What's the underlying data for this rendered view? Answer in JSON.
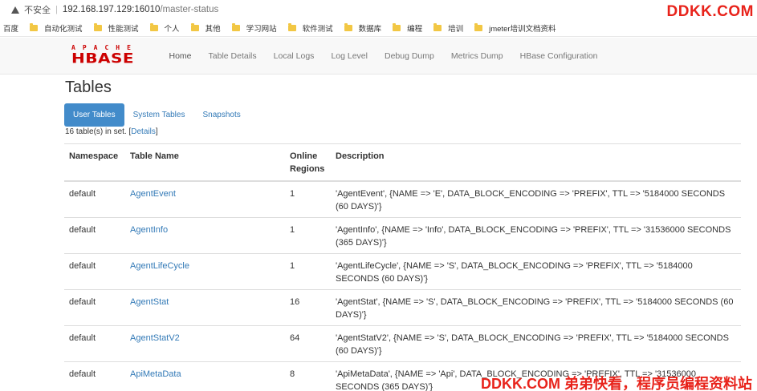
{
  "browser": {
    "security_label": "不安全",
    "url_host": "192.168.197.129:16010",
    "url_path": "/master-status"
  },
  "bookmarks": [
    "百度",
    "自动化测试",
    "性能测试",
    "个人",
    "其他",
    "学习网站",
    "软件测试",
    "数据库",
    "编程",
    "培训",
    "jmeter培训文档资料"
  ],
  "watermark": {
    "top": "DDKK.COM",
    "bottom": "DDKK.COM 弟弟快看，程序员编程资料站"
  },
  "logo": {
    "apache": "APACHE",
    "hbase": "HBASE"
  },
  "nav": [
    "Home",
    "Table Details",
    "Local Logs",
    "Log Level",
    "Debug Dump",
    "Metrics Dump",
    "HBase Configuration"
  ],
  "page_title": "Tables",
  "tabs": [
    "User Tables",
    "System Tables",
    "Snapshots"
  ],
  "count_text": "16 table(s) in set. [",
  "details_link": "Details",
  "count_suffix": "]",
  "table": {
    "headers": {
      "namespace": "Namespace",
      "name": "Table Name",
      "regions_1": "Online",
      "regions_2": "Regions",
      "description": "Description"
    },
    "rows": [
      {
        "namespace": "default",
        "name": "AgentEvent",
        "regions": "1",
        "description": "'AgentEvent', {NAME => 'E', DATA_BLOCK_ENCODING => 'PREFIX', TTL => '5184000 SECONDS (60 DAYS)'}"
      },
      {
        "namespace": "default",
        "name": "AgentInfo",
        "regions": "1",
        "description": "'AgentInfo', {NAME => 'Info', DATA_BLOCK_ENCODING => 'PREFIX', TTL => '31536000 SECONDS (365 DAYS)'}"
      },
      {
        "namespace": "default",
        "name": "AgentLifeCycle",
        "regions": "1",
        "description": "'AgentLifeCycle', {NAME => 'S', DATA_BLOCK_ENCODING => 'PREFIX', TTL => '5184000 SECONDS (60 DAYS)'}"
      },
      {
        "namespace": "default",
        "name": "AgentStat",
        "regions": "16",
        "description": "'AgentStat', {NAME => 'S', DATA_BLOCK_ENCODING => 'PREFIX', TTL => '5184000 SECONDS (60 DAYS)'}"
      },
      {
        "namespace": "default",
        "name": "AgentStatV2",
        "regions": "64",
        "description": "'AgentStatV2', {NAME => 'S', DATA_BLOCK_ENCODING => 'PREFIX', TTL => '5184000 SECONDS (60 DAYS)'}"
      },
      {
        "namespace": "default",
        "name": "ApiMetaData",
        "regions": "8",
        "description": "'ApiMetaData', {NAME => 'Api', DATA_BLOCK_ENCODING => 'PREFIX', TTL => '31536000 SECONDS (365 DAYS)'}"
      }
    ]
  }
}
